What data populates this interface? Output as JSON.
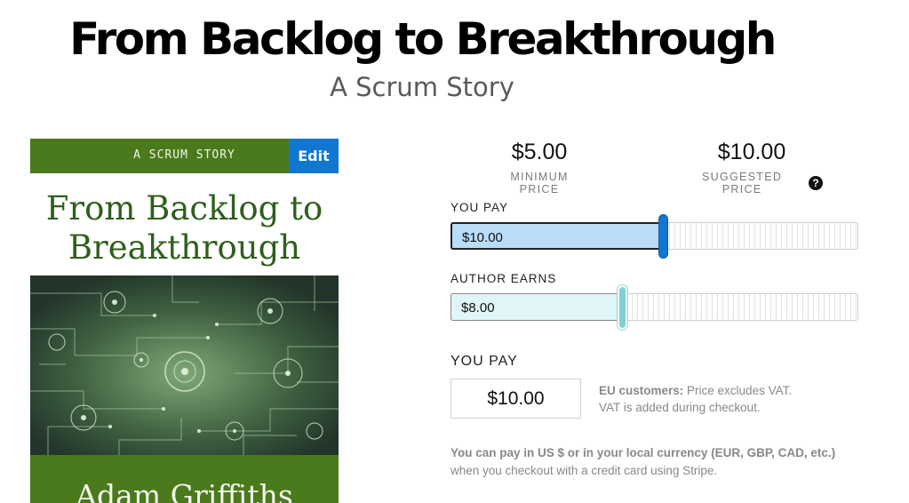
{
  "header": {
    "title": "From Backlog to Breakthrough",
    "subtitle": "A Scrum Story"
  },
  "cover": {
    "series_label": "A SCRUM STORY",
    "edit_label": "Edit",
    "title_line1": "From Backlog to",
    "title_line2": "Breakthrough",
    "author": "Adam Griffiths",
    "colors": {
      "band": "#4a7a1c",
      "title": "#2f5f1b",
      "edit": "#1177d1"
    }
  },
  "pricing": {
    "minimum": {
      "value": "$5.00",
      "caption": "MINIMUM PRICE"
    },
    "suggested": {
      "value": "$10.00",
      "caption": "SUGGESTED PRICE"
    },
    "help_icon": "question-circle-icon",
    "you_pay_slider": {
      "label": "YOU PAY",
      "value": "$10.00",
      "fraction": 0.52
    },
    "author_earns_slider": {
      "label": "AUTHOR EARNS",
      "value": "$8.00",
      "fraction": 0.42
    },
    "you_pay_input": {
      "label": "YOU PAY",
      "value": "$10.00"
    },
    "vat_note": {
      "bold": "EU customers:",
      "line1_rest": " Price excludes VAT.",
      "line2": "VAT is added during checkout."
    },
    "currency_note": {
      "bold": "You can pay in US $ or in your local currency (EUR, GBP, CAD, etc.)",
      "line2": "when you checkout with a credit card using Stripe."
    }
  }
}
